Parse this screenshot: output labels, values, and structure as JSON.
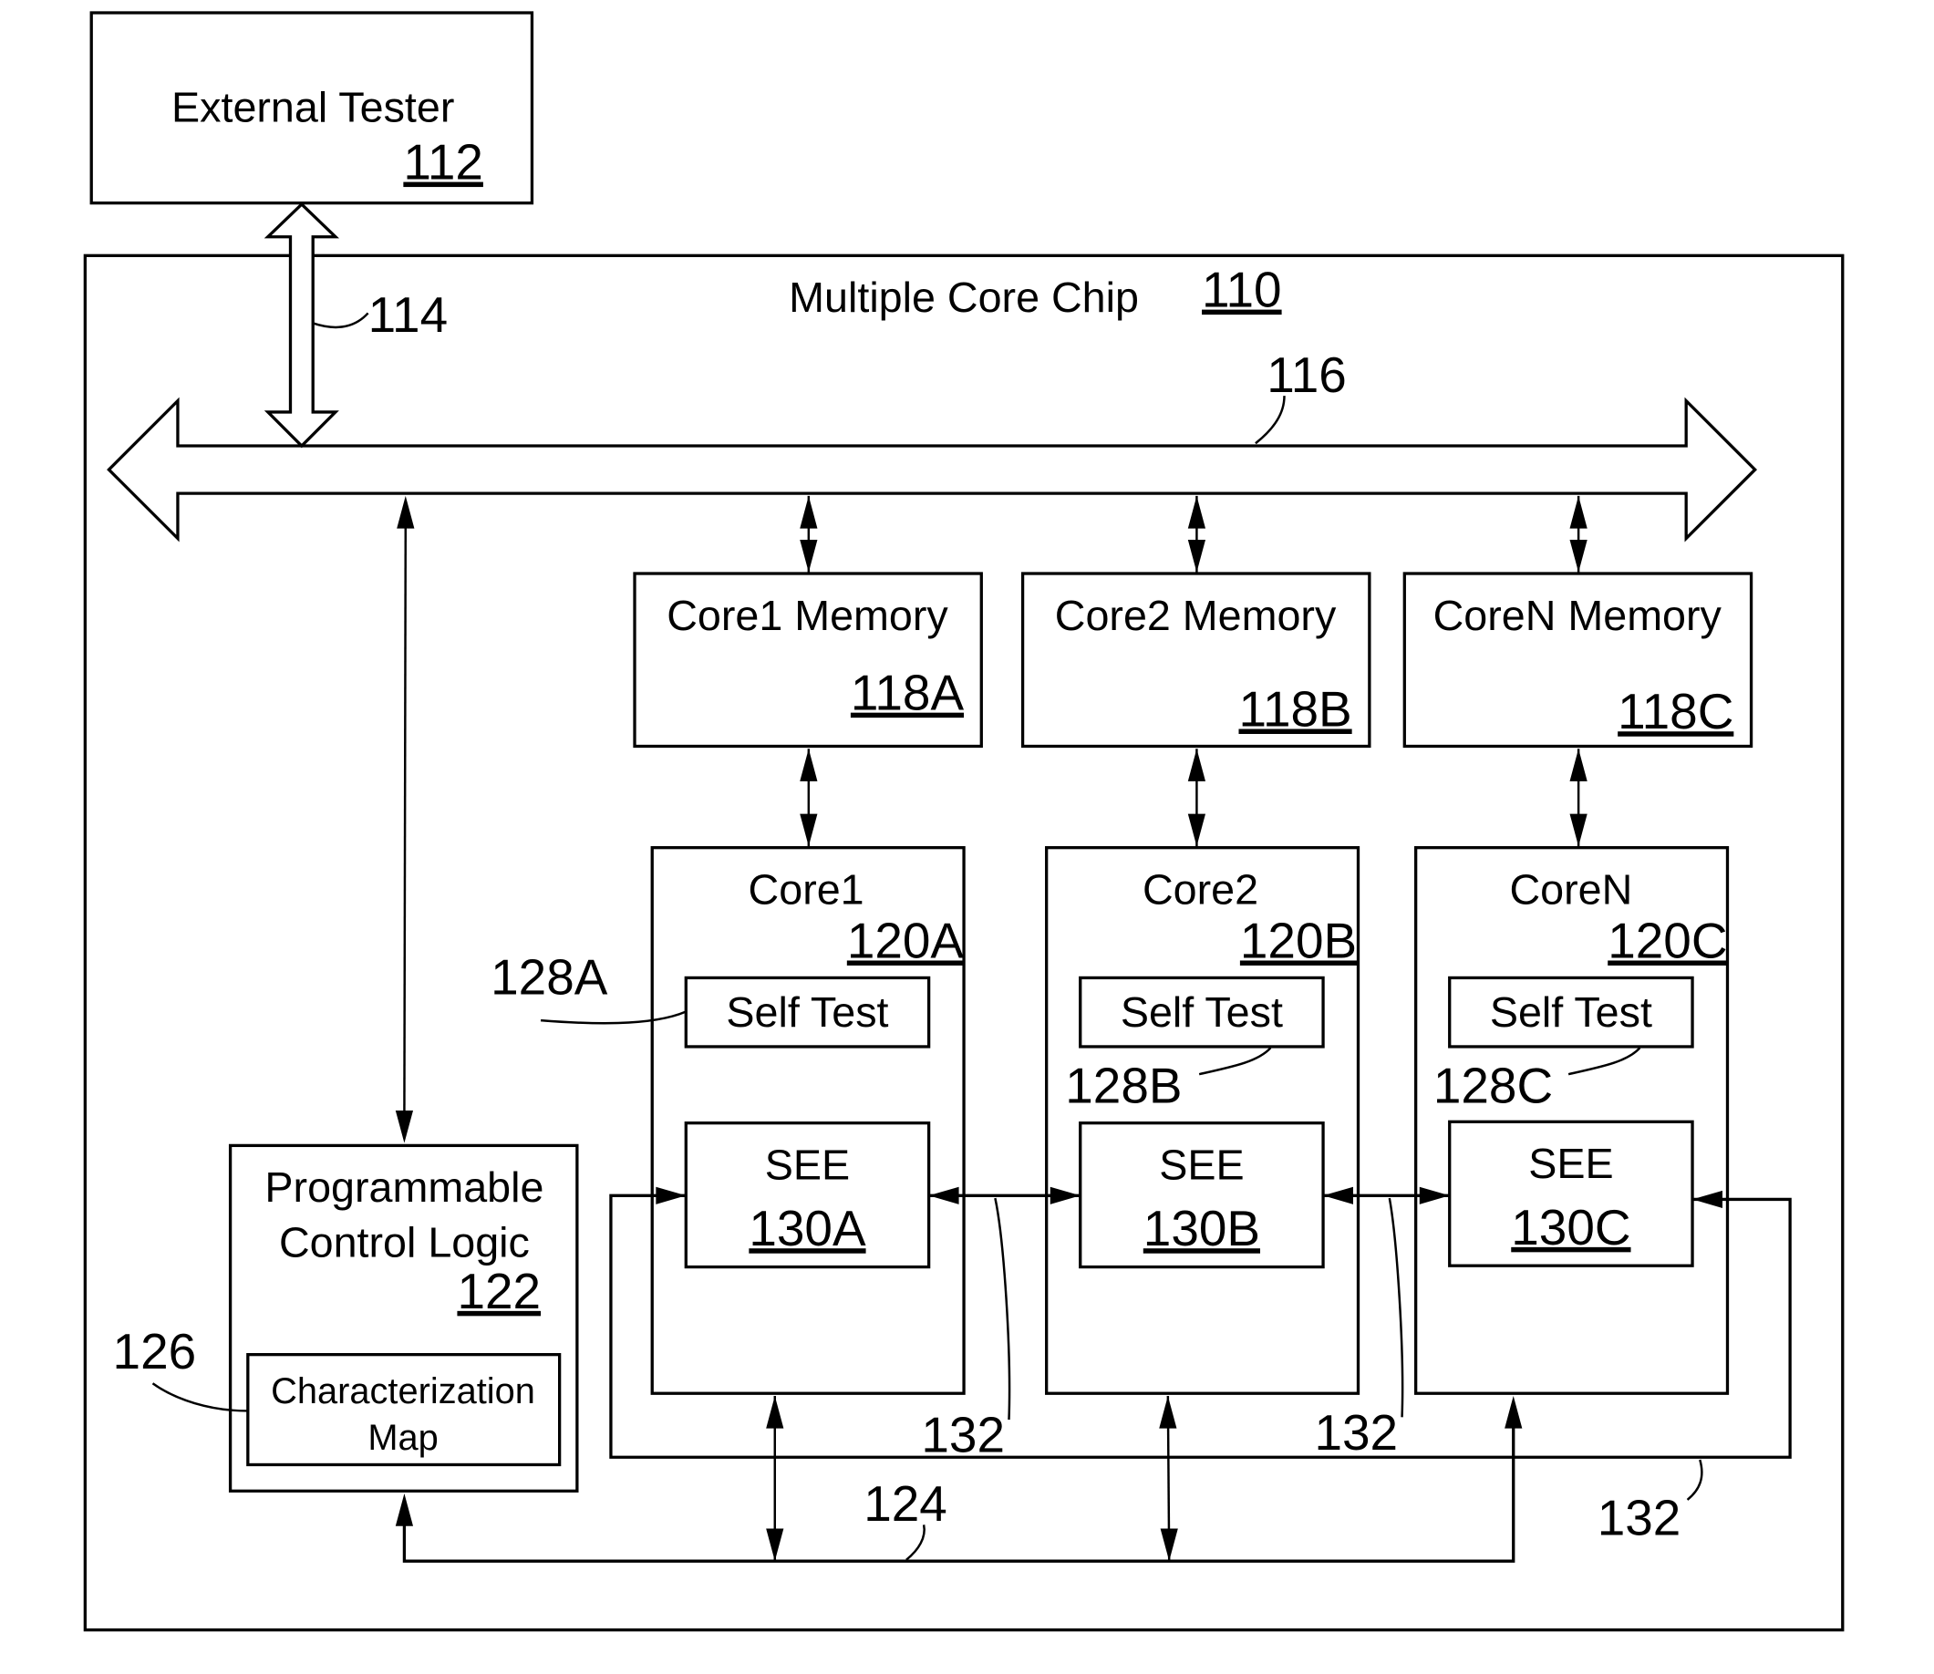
{
  "external_tester": {
    "title": "External Tester",
    "ref": "112"
  },
  "link_114": {
    "ref": "114"
  },
  "chip": {
    "title": "Multiple Core Chip",
    "ref": "110"
  },
  "bus_116": {
    "ref": "116"
  },
  "memories": [
    {
      "title": "Core1 Memory",
      "ref": "118A"
    },
    {
      "title": "Core2 Memory",
      "ref": "118B"
    },
    {
      "title": "CoreN Memory",
      "ref": "118C"
    }
  ],
  "cores": [
    {
      "title": "Core1",
      "ref": "120A",
      "self_test": "Self Test",
      "self_test_ref": "128A",
      "see_title": "SEE",
      "see_ref": "130A"
    },
    {
      "title": "Core2",
      "ref": "120B",
      "self_test": "Self Test",
      "self_test_ref": "128B",
      "see_title": "SEE",
      "see_ref": "130B"
    },
    {
      "title": "CoreN",
      "ref": "120C",
      "self_test": "Self Test",
      "self_test_ref": "128C",
      "see_title": "SEE",
      "see_ref": "130C"
    }
  ],
  "control_logic": {
    "line1": "Programmable",
    "line2": "Control Logic",
    "ref": "122"
  },
  "char_map": {
    "line1": "Characterization",
    "line2": "Map",
    "ref": "126"
  },
  "bus_124": {
    "ref": "124"
  },
  "links_132": [
    "132",
    "132",
    "132"
  ]
}
